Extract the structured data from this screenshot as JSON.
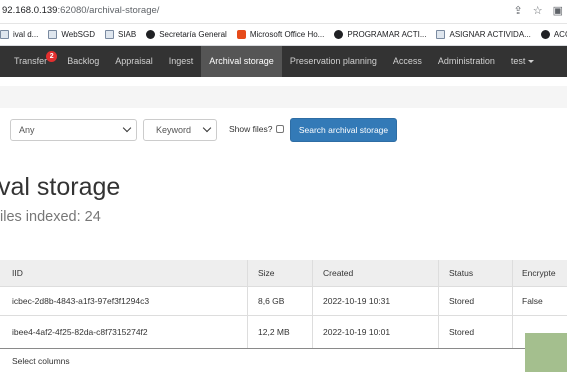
{
  "browser": {
    "url_host": "92.168.0.139",
    "url_path": ":62080/archival-storage/",
    "bookmarks": [
      {
        "label": "ival d...",
        "icon": "doc-icon"
      },
      {
        "label": "WebSGD",
        "icon": "doc-icon"
      },
      {
        "label": "SIAB",
        "icon": "doc-icon"
      },
      {
        "label": "Secretaría General",
        "icon": "globe-icon"
      },
      {
        "label": "Microsoft Office Ho...",
        "icon": "office-icon"
      },
      {
        "label": "PROGRAMAR ACTI...",
        "icon": "globe-icon"
      },
      {
        "label": "ASIGNAR ACTIVIDA...",
        "icon": "doc-icon"
      },
      {
        "label": "ACOPIO",
        "icon": "globe-icon"
      }
    ]
  },
  "nav": {
    "items": [
      "Transfer",
      "Backlog",
      "Appraisal",
      "Ingest",
      "Archival storage",
      "Preservation planning",
      "Access",
      "Administration",
      "test"
    ],
    "active": "Archival storage",
    "transfer_badge": "2"
  },
  "search": {
    "scope_value": "Any",
    "field_value": "Keyword",
    "show_files_label": "Show files?",
    "button_label": "Search archival storage"
  },
  "page": {
    "title": "val storage",
    "subtitle": "iles indexed: 24"
  },
  "table": {
    "headers": [
      "IID",
      "Size",
      "Created",
      "Status",
      "Encrypte"
    ],
    "rows": [
      [
        "icbec-2d8b-4843-a1f3-97ef3f1294c3",
        "8,6 GB",
        "2022-10-19 10:31",
        "Stored",
        "False"
      ],
      [
        "ibee4-4af2-4f25-82da-c8f7315274f2",
        "12,2 MB",
        "2022-10-19 10:01",
        "Stored",
        ""
      ]
    ],
    "select_columns_label": "Select columns"
  },
  "colors": {
    "navbar": "#333333",
    "nav_active": "#555555",
    "primary_button": "#337ab7",
    "badge": "#e32f2f"
  }
}
